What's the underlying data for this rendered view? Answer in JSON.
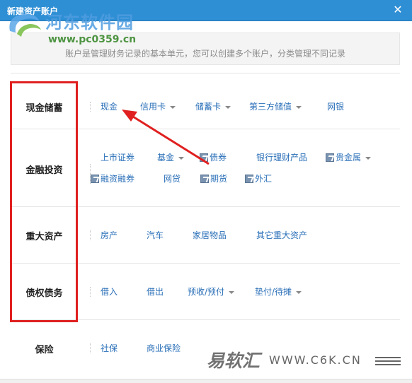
{
  "window": {
    "title": "新建资产账户",
    "close_icon": "close-icon"
  },
  "watermark": {
    "site_name": "河东软件园",
    "site_url": "www.pc0359.cn"
  },
  "description": "账户是管理财务记录的基本单元，您可以创建多个账户，分类管理不同记录",
  "categories": [
    {
      "label": "现金储蓄",
      "options": [
        {
          "label": "现金",
          "has_caret": false,
          "has_icon": false
        },
        {
          "label": "信用卡",
          "has_caret": true,
          "has_icon": false
        },
        {
          "label": "储蓄卡",
          "has_caret": true,
          "has_icon": false
        },
        {
          "label": "第三方储值",
          "has_caret": true,
          "has_icon": false
        },
        {
          "label": "网银",
          "has_caret": false,
          "has_icon": false
        }
      ]
    },
    {
      "label": "金融投资",
      "options": [
        {
          "label": "上市证券",
          "has_caret": false,
          "has_icon": false
        },
        {
          "label": "基金",
          "has_caret": true,
          "has_icon": false
        },
        {
          "label": "债券",
          "has_caret": false,
          "has_icon": true
        },
        {
          "label": "银行理财产品",
          "has_caret": false,
          "has_icon": false
        },
        {
          "label": "贵金属",
          "has_caret": true,
          "has_icon": true
        },
        {
          "label": "融资融券",
          "has_caret": false,
          "has_icon": true
        },
        {
          "label": "网贷",
          "has_caret": false,
          "has_icon": false
        },
        {
          "label": "期货",
          "has_caret": false,
          "has_icon": true
        },
        {
          "label": "外汇",
          "has_caret": false,
          "has_icon": true
        }
      ]
    },
    {
      "label": "重大资产",
      "options": [
        {
          "label": "房产",
          "has_caret": false,
          "has_icon": false
        },
        {
          "label": "汽车",
          "has_caret": false,
          "has_icon": false
        },
        {
          "label": "家居物品",
          "has_caret": false,
          "has_icon": false
        },
        {
          "label": "其它重大资产",
          "has_caret": false,
          "has_icon": false
        }
      ]
    },
    {
      "label": "债权债务",
      "options": [
        {
          "label": "借入",
          "has_caret": false,
          "has_icon": false
        },
        {
          "label": "借出",
          "has_caret": false,
          "has_icon": false
        },
        {
          "label": "预收/预付",
          "has_caret": true,
          "has_icon": false
        },
        {
          "label": "垫付/待摊",
          "has_caret": true,
          "has_icon": false
        }
      ]
    },
    {
      "label": "保险",
      "options": [
        {
          "label": "社保",
          "has_caret": false,
          "has_icon": false
        },
        {
          "label": "商业保险",
          "has_caret": false,
          "has_icon": false
        }
      ]
    }
  ],
  "brand_watermark": {
    "name": "易软汇",
    "url": "WWW.C6K.CN"
  },
  "colors": {
    "title_bar": "#2f8fd4",
    "link": "#2a6fb8",
    "highlight_box": "#e02020"
  }
}
